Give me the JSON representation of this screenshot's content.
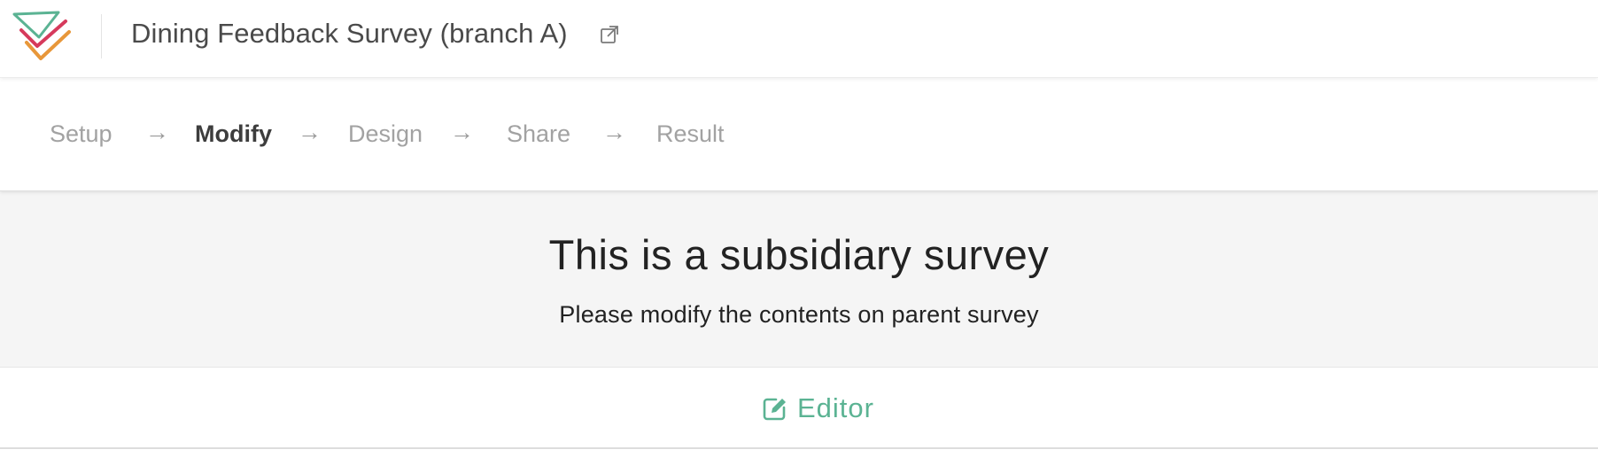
{
  "header": {
    "survey_title": "Dining Feedback Survey (branch A)",
    "logo_icon": "checkmark-stack-logo",
    "open_icon": "external-link-icon"
  },
  "steps": [
    {
      "label": "Setup",
      "active": false
    },
    {
      "label": "Modify",
      "active": true
    },
    {
      "label": "Design",
      "active": false
    },
    {
      "label": "Share",
      "active": false
    },
    {
      "label": "Result",
      "active": false
    }
  ],
  "step_separator": "→",
  "notice": {
    "title": "This is a subsidiary survey",
    "subtitle": "Please modify the contents on parent survey"
  },
  "editor": {
    "label": "Editor",
    "icon": "edit-icon"
  },
  "colors": {
    "accent": "#5bb393",
    "logo_green": "#5bb393",
    "logo_red": "#d63a5c",
    "logo_orange": "#e8973a",
    "notice_bg": "#f5f5f5"
  }
}
